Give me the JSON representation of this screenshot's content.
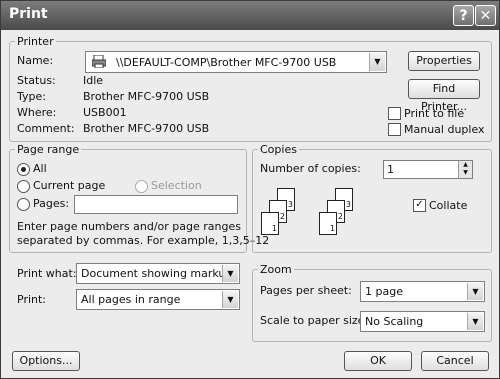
{
  "window": {
    "title": "Print",
    "help_label": "?",
    "close_label": "✕"
  },
  "printer": {
    "group_label": "Printer",
    "name_label": "Name:",
    "name_value": "\\\\DEFAULT-COMP\\Brother MFC-9700 USB",
    "status_label": "Status:",
    "status_value": "Idle",
    "type_label": "Type:",
    "type_value": "Brother MFC-9700 USB",
    "where_label": "Where:",
    "where_value": "USB001",
    "comment_label": "Comment:",
    "comment_value": "Brother MFC-9700 USB",
    "properties_button": "Properties",
    "find_button": "Find Printer...",
    "print_to_file_label": "Print to file",
    "manual_duplex_label": "Manual duplex"
  },
  "page_range": {
    "group_label": "Page range",
    "all_label": "All",
    "current_label": "Current page",
    "selection_label": "Selection",
    "pages_label": "Pages:",
    "pages_value": "",
    "help_line1": "Enter page numbers and/or page ranges",
    "help_line2": "separated by commas.  For example, 1,3,5–12"
  },
  "copies": {
    "group_label": "Copies",
    "number_label": "Number of copies:",
    "number_value": "1",
    "collate_label": "Collate",
    "collate_checked": true
  },
  "print_what": {
    "label": "Print what:",
    "value": "Document showing markup"
  },
  "print": {
    "label": "Print:",
    "value": "All pages in range"
  },
  "zoom": {
    "group_label": "Zoom",
    "pages_per_sheet_label": "Pages per sheet:",
    "pages_per_sheet_value": "1 page",
    "scale_label": "Scale to paper size:",
    "scale_value": "No Scaling"
  },
  "footer": {
    "options_button": "Options...",
    "ok_button": "OK",
    "cancel_button": "Cancel"
  }
}
